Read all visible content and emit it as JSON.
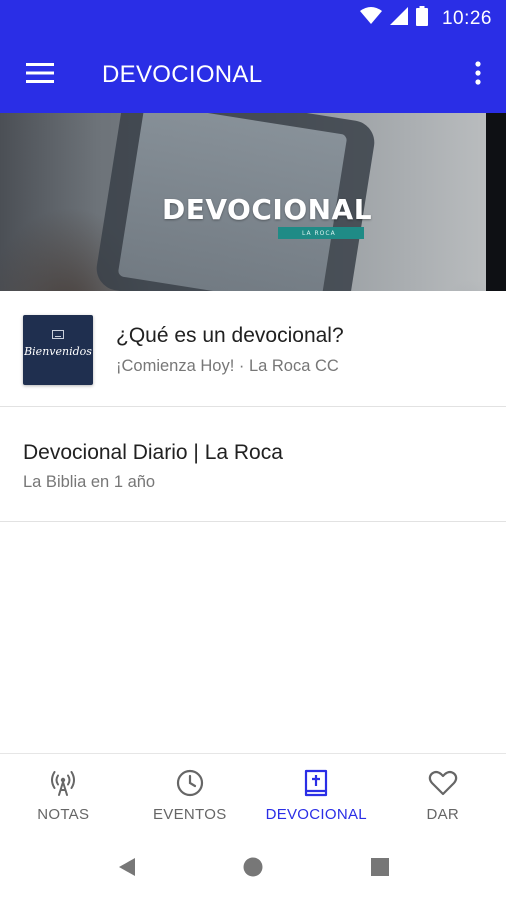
{
  "status_bar": {
    "time": "10:26",
    "icons": [
      "wifi-icon",
      "signal-icon",
      "battery-icon"
    ]
  },
  "app_bar": {
    "title": "DEVOCIONAL",
    "menu_icon": "hamburger-menu-icon",
    "overflow_icon": "more-vert-icon"
  },
  "banner": {
    "title": "DEVOCIONAL",
    "tag": "LA ROCA"
  },
  "items": [
    {
      "title": "¿Qué es un devocional?",
      "subtitle": "¡Comienza Hoy! · La Roca CC",
      "thumbnail_text": "Bienvenidos"
    },
    {
      "title": "Devocional Diario | La Roca",
      "subtitle": "La Biblia en 1 año"
    }
  ],
  "bottom_nav": {
    "tabs": [
      {
        "label": "NOTAS",
        "icon": "broadcast-icon",
        "active": false
      },
      {
        "label": "EVENTOS",
        "icon": "clock-icon",
        "active": false
      },
      {
        "label": "DEVOCIONAL",
        "icon": "bible-icon",
        "active": true
      },
      {
        "label": "DAR",
        "icon": "heart-icon",
        "active": false
      }
    ]
  },
  "colors": {
    "primary": "#2a2ee6",
    "text_primary": "#212121",
    "text_secondary": "#777777",
    "nav_inactive": "#666666"
  }
}
